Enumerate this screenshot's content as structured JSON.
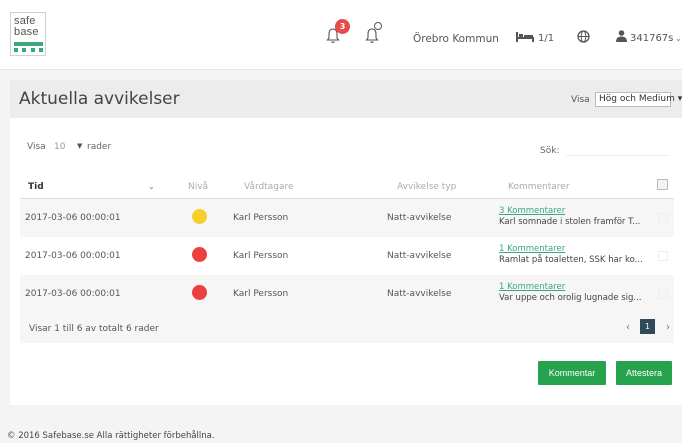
{
  "brand": {
    "line1": "safe",
    "line2": "base"
  },
  "header": {
    "notification_count": "3",
    "organization": "Örebro Kommun",
    "bed_count": "1/1",
    "username": "341767s",
    "user_chevron": "⌄"
  },
  "page": {
    "title": "Aktuella avvikelser",
    "filter_label": "Visa",
    "filter_value": "Hög och Medium ▾"
  },
  "controls": {
    "length_prefix": "Visa",
    "length_value": "10",
    "length_caret": "▼",
    "length_suffix": "rader",
    "search_label": "Sök:",
    "search_value": ""
  },
  "table": {
    "columns": {
      "tid": "Tid",
      "sort_icon": "⌄",
      "niva": "Nivå",
      "vardtagare": "Vårdtagare",
      "typ": "Avvikelse typ",
      "kommentarer": "Kommentarer"
    },
    "rows": [
      {
        "tid": "2017-03-06 00:00:01",
        "level_color": "#f7ce2e",
        "vardtagare": "Karl Persson",
        "typ": "Natt-avvikelse",
        "comment_link": "3 Kommentarer",
        "comment_text": "Karl somnade i stolen framför T..."
      },
      {
        "tid": "2017-03-06 00:00:01",
        "level_color": "#ee3f3f",
        "vardtagare": "Karl Persson",
        "typ": "Natt-avvikelse",
        "comment_link": "1 Kommentarer",
        "comment_text": "Ramlat på toaletten, SSK har ko..."
      },
      {
        "tid": "2017-03-06 00:00:01",
        "level_color": "#ee3f3f",
        "vardtagare": "Karl Persson",
        "typ": "Natt-avvikelse",
        "comment_link": "1 Kommentarer",
        "comment_text": "Var uppe och orolig lugnade sig..."
      }
    ],
    "info": "Visar 1 till 6 av totalt 6 rader",
    "pagination": {
      "prev": "‹",
      "current": "1",
      "next": "›"
    }
  },
  "actions": {
    "comment_label": "Kommentar",
    "attest_label": "Attestera"
  },
  "footer": {
    "copyright": "© 2016 Safebase.se Alla rättigheter förbehållna."
  },
  "colors": {
    "accent": "#27a24f",
    "link": "#3aa87a",
    "badge": "#e84a4a",
    "pager": "#2f4a5a"
  },
  "icons": [
    "bell-icon",
    "bell-settings-icon",
    "bed-icon",
    "globe-icon",
    "user-icon"
  ]
}
